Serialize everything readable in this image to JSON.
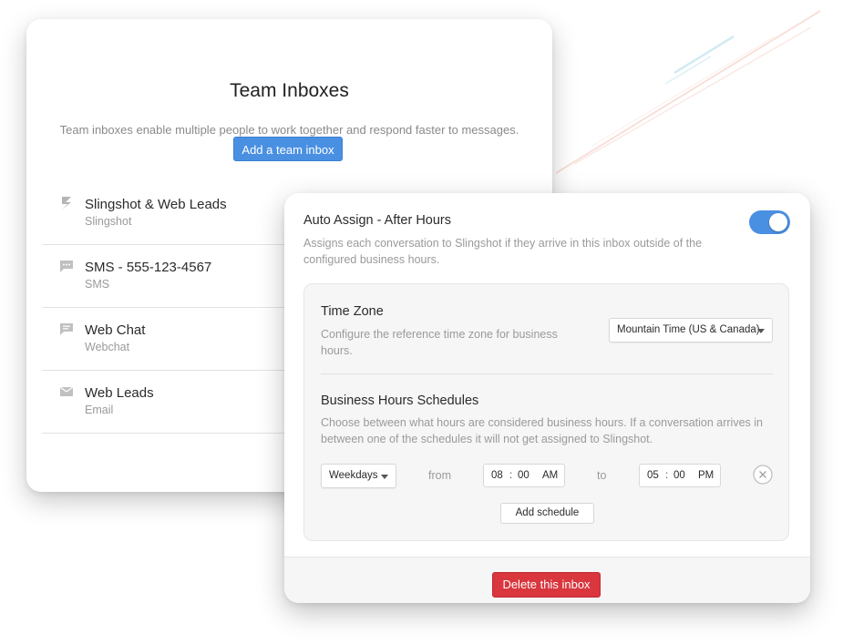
{
  "team_inboxes": {
    "title": "Team Inboxes",
    "subtitle": "Team inboxes enable multiple people to work together and respond faster to messages.",
    "add_button_label": "Add a team inbox",
    "inboxes": [
      {
        "name": "Slingshot & Web Leads",
        "type": "Slingshot",
        "icon": "slingshot-icon"
      },
      {
        "name": "SMS - 555-123-4567",
        "type": "SMS",
        "icon": "sms-icon"
      },
      {
        "name": "Web Chat",
        "type": "Webchat",
        "icon": "chat-icon"
      },
      {
        "name": "Web Leads",
        "type": "Email",
        "icon": "email-icon"
      }
    ]
  },
  "inbox_settings": {
    "auto_assign": {
      "title": "Auto Assign - After Hours",
      "description": "Assigns each conversation to Slingshot if they arrive in this inbox outside of the configured business hours.",
      "enabled": true
    },
    "time_zone": {
      "title": "Time Zone",
      "description": "Configure the reference time zone for business hours.",
      "selected": "Mountain Time (US & Canada)"
    },
    "business_hours": {
      "title": "Business Hours Schedules",
      "description": "Choose between what hours are considered business hours. If a conversation arrives in between one of the schedules it will not get assigned to Slingshot.",
      "schedules": [
        {
          "days": "Weekdays",
          "from_label": "from",
          "start_hour": "08",
          "start_minute": "00",
          "start_period": "AM",
          "to_label": "to",
          "end_hour": "05",
          "end_minute": "00",
          "end_period": "PM"
        }
      ],
      "add_schedule_label": "Add schedule"
    },
    "delete_button_label": "Delete this inbox"
  },
  "colors": {
    "accent": "#4a90e2",
    "danger": "#d9363e"
  }
}
